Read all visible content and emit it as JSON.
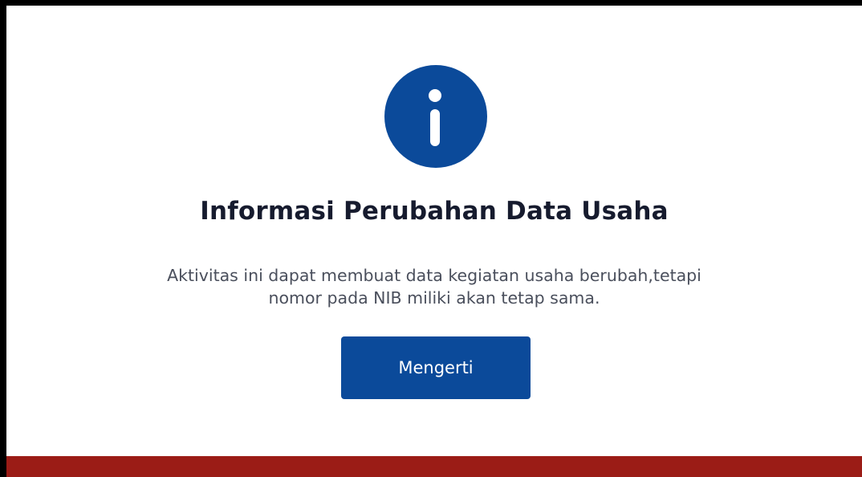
{
  "dialog": {
    "icon": "info-icon",
    "title": "Informasi Perubahan Data Usaha",
    "message_line1": "Aktivitas ini dapat membuat data kegiatan usaha berubah,tetapi",
    "message_line2": "nomor pada NIB miliki akan tetap sama.",
    "confirm_label": "Mengerti"
  },
  "colors": {
    "primary": "#0b4a9a",
    "bottom_bar": "#9b1c16",
    "title_text": "#161b2e",
    "message_text": "#4a4f5c"
  }
}
